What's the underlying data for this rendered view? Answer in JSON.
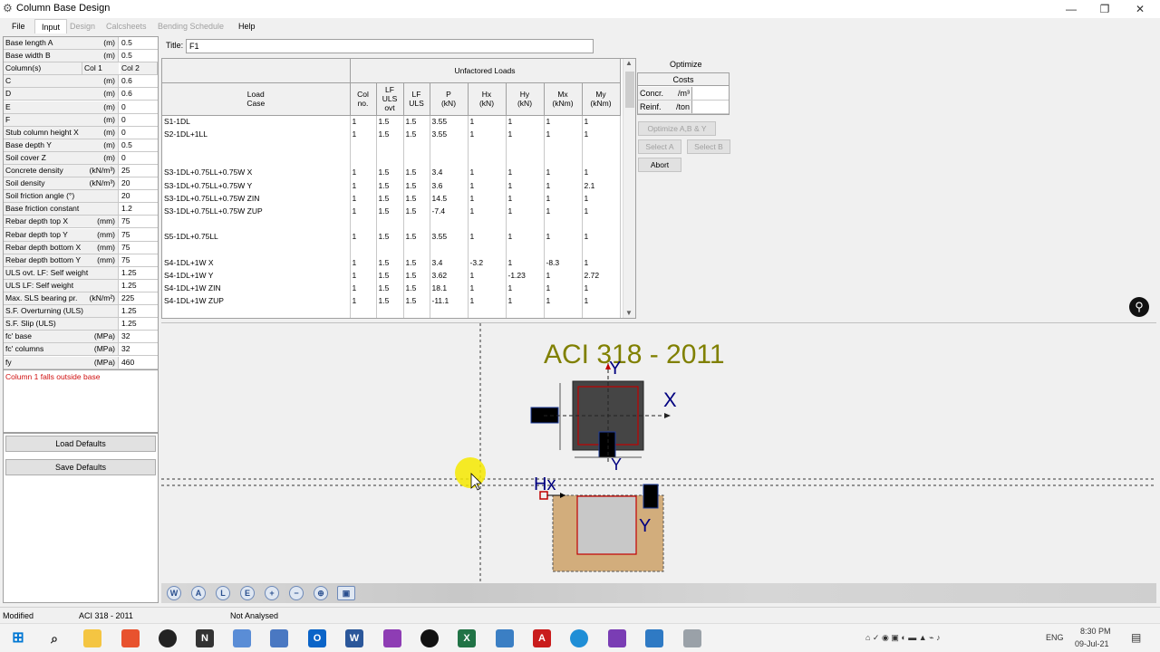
{
  "window": {
    "title": "Column Base Design",
    "minimize": "—",
    "maximize": "❐",
    "close": "✕"
  },
  "menu": [
    "File",
    "Input",
    "Design",
    "Calcsheets",
    "Bending Schedule",
    "Help"
  ],
  "params": [
    {
      "label": "Base length A",
      "unit": "(m)",
      "value": "0.5"
    },
    {
      "label": "Base width B",
      "unit": "(m)",
      "value": "0.5"
    },
    {
      "label": "Column(s)",
      "col1": "Col 1",
      "col2": "Col 2"
    },
    {
      "label": "C",
      "unit": "(m)",
      "value": "0.6"
    },
    {
      "label": "D",
      "unit": "(m)",
      "value": "0.6"
    },
    {
      "label": "E",
      "unit": "(m)",
      "value": "0"
    },
    {
      "label": "F",
      "unit": "(m)",
      "value": "0"
    },
    {
      "label": "Stub column height X",
      "unit": "(m)",
      "value": "0"
    },
    {
      "label": "Base depth Y",
      "unit": "(m)",
      "value": "0.5"
    },
    {
      "label": "Soil cover Z",
      "unit": "(m)",
      "value": "0"
    },
    {
      "label": "Concrete density",
      "unit": "(kN/m³)",
      "value": "25"
    },
    {
      "label": "Soil density",
      "unit": "(kN/m³)",
      "value": "20"
    },
    {
      "label": "Soil friction angle (°)",
      "unit": "",
      "value": "20"
    },
    {
      "label": "Base friction constant",
      "unit": "",
      "value": "1.2"
    },
    {
      "label": "Rebar depth top X",
      "unit": "(mm)",
      "value": "75"
    },
    {
      "label": "Rebar depth top Y",
      "unit": "(mm)",
      "value": "75"
    },
    {
      "label": "Rebar depth bottom X",
      "unit": "(mm)",
      "value": "75"
    },
    {
      "label": "Rebar depth bottom Y",
      "unit": "(mm)",
      "value": "75"
    },
    {
      "label": "ULS ovt. LF: Self weight",
      "unit": "",
      "value": "1.25"
    },
    {
      "label": "ULS LF: Self weight",
      "unit": "",
      "value": "1.25"
    },
    {
      "label": "Max. SLS bearing pr.",
      "unit": "(kN/m²)",
      "value": "225"
    },
    {
      "label": "S.F. Overturning (ULS)",
      "unit": "",
      "value": "1.25"
    },
    {
      "label": "S.F. Slip (ULS)",
      "unit": "",
      "value": "1.25"
    },
    {
      "label": "fc' base",
      "unit": "(MPa)",
      "value": "32"
    },
    {
      "label": "fc' columns",
      "unit": "(MPa)",
      "value": "32"
    },
    {
      "label": "fy",
      "unit": "(MPa)",
      "value": "460"
    }
  ],
  "message": "Column 1 falls outside base",
  "buttons": {
    "load_defaults": "Load Defaults",
    "save_defaults": "Save Defaults"
  },
  "title_field": {
    "label": "Title:",
    "value": "F1"
  },
  "grid": {
    "group_header": "Unfactored Loads",
    "headers": [
      "Load\nCase",
      "Col\nno.",
      "LF\nULS\novt",
      "LF\nULS",
      "P\n(kN)",
      "Hx\n(kN)",
      "Hy\n(kN)",
      "Mx\n(kNm)",
      "My\n(kNm)"
    ],
    "rows": [
      [
        "S1-1DL",
        "1",
        "1.5",
        "1.5",
        "3.55",
        "1",
        "1",
        "1",
        "1"
      ],
      [
        "S2-1DL+1LL",
        "1",
        "1.5",
        "1.5",
        "3.55",
        "1",
        "1",
        "1",
        "1"
      ],
      [
        "",
        "",
        "",
        "",
        "",
        "",
        "",
        "",
        ""
      ],
      [
        "",
        "",
        "",
        "",
        "",
        "",
        "",
        "",
        ""
      ],
      [
        "S3-1DL+0.75LL+0.75W X",
        "1",
        "1.5",
        "1.5",
        "3.4",
        "1",
        "1",
        "1",
        "1"
      ],
      [
        "S3-1DL+0.75LL+0.75W Y",
        "1",
        "1.5",
        "1.5",
        "3.6",
        "1",
        "1",
        "1",
        "2.1"
      ],
      [
        "S3-1DL+0.75LL+0.75W ZIN",
        "1",
        "1.5",
        "1.5",
        "14.5",
        "1",
        "1",
        "1",
        "1"
      ],
      [
        "S3-1DL+0.75LL+0.75W ZUP",
        "1",
        "1.5",
        "1.5",
        "-7.4",
        "1",
        "1",
        "1",
        "1"
      ],
      [
        "",
        "",
        "",
        "",
        "",
        "",
        "",
        "",
        ""
      ],
      [
        "S5-1DL+0.75LL",
        "1",
        "1.5",
        "1.5",
        "3.55",
        "1",
        "1",
        "1",
        "1"
      ],
      [
        "",
        "",
        "",
        "",
        "",
        "",
        "",
        "",
        ""
      ],
      [
        "S4-1DL+1W X",
        "1",
        "1.5",
        "1.5",
        "3.4",
        "-3.2",
        "1",
        "-8.3",
        "1"
      ],
      [
        "S4-1DL+1W Y",
        "1",
        "1.5",
        "1.5",
        "3.62",
        "1",
        "-1.23",
        "1",
        "2.72"
      ],
      [
        "S4-1DL+1W ZIN",
        "1",
        "1.5",
        "1.5",
        "18.1",
        "1",
        "1",
        "1",
        "1"
      ],
      [
        "S4-1DL+1W ZUP",
        "1",
        "1.5",
        "1.5",
        "-11.1",
        "1",
        "1",
        "1",
        "1"
      ],
      [
        "",
        "",
        "",
        "",
        "",
        "",
        "",
        "",
        ""
      ]
    ]
  },
  "optimize": {
    "title": "Optimize",
    "costs_header": "Costs",
    "concr_label": "Concr.",
    "concr_unit": "/m³",
    "reinf_label": "Reinf.",
    "reinf_unit": "/ton",
    "optimize_btn": "Optimize A,B & Y",
    "select_a": "Select A",
    "select_b": "Select B",
    "abort": "Abort"
  },
  "drawing": {
    "code_title": "ACI 318 - 2011",
    "axis_x": "X",
    "axis_y": "Y",
    "hx": "Hx",
    "colors": {
      "title": "#808000",
      "axis": "#000080",
      "column": "#404040",
      "base_outline": "#c00000",
      "soil": "#d2ad7c"
    }
  },
  "toolbar_icons": [
    "W",
    "A",
    "L",
    "E",
    "+",
    "−",
    "⊕",
    "▣"
  ],
  "status": {
    "left": "Modified",
    "code": "ACI 318 - 2011",
    "state": "Not Analysed"
  },
  "taskbar": {
    "time": "8:30 PM",
    "date": "09-Jul-21",
    "lang": "ENG"
  }
}
